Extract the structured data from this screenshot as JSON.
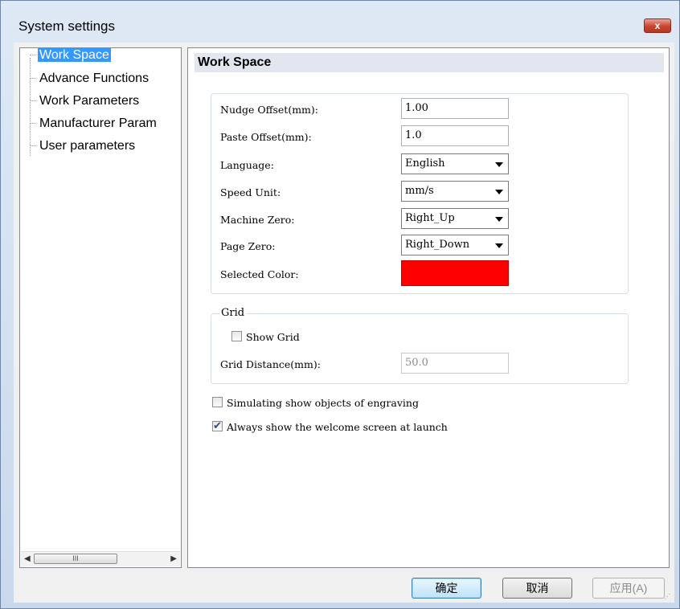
{
  "window": {
    "title": "System settings",
    "close_glyph": "x"
  },
  "tree": {
    "items": [
      {
        "label": "Work Space",
        "selected": true
      },
      {
        "label": "Advance Functions"
      },
      {
        "label": "Work Parameters"
      },
      {
        "label": "Manufacturer Param"
      },
      {
        "label": "User parameters"
      }
    ],
    "scroll_thumb_glyph": "III"
  },
  "panel": {
    "header": "Work Space",
    "fields": {
      "nudge_offset": {
        "label": "Nudge Offset(mm):",
        "value": "1.00"
      },
      "paste_offset": {
        "label": "Paste Offset(mm):",
        "value": "1.0"
      },
      "language": {
        "label": "Language:",
        "value": "English"
      },
      "speed_unit": {
        "label": "Speed Unit:",
        "value": "mm/s"
      },
      "machine_zero": {
        "label": "Machine Zero:",
        "value": "Right_Up"
      },
      "page_zero": {
        "label": "Page Zero:",
        "value": "Right_Down"
      },
      "selected_color": {
        "label": "Selected Color:",
        "color": "#ff0000"
      }
    },
    "grid": {
      "legend": "Grid",
      "show_grid": {
        "label": "Show Grid",
        "checked": false
      },
      "distance": {
        "label": "Grid Distance(mm):",
        "value": "50.0"
      }
    },
    "options": {
      "simulating": {
        "label": "Simulating show objects of engraving",
        "checked": false
      },
      "welcome": {
        "label": "Always show the welcome screen at launch",
        "checked": true
      }
    }
  },
  "buttons": {
    "ok": "确定",
    "cancel": "取消",
    "apply": "应用(A)"
  }
}
